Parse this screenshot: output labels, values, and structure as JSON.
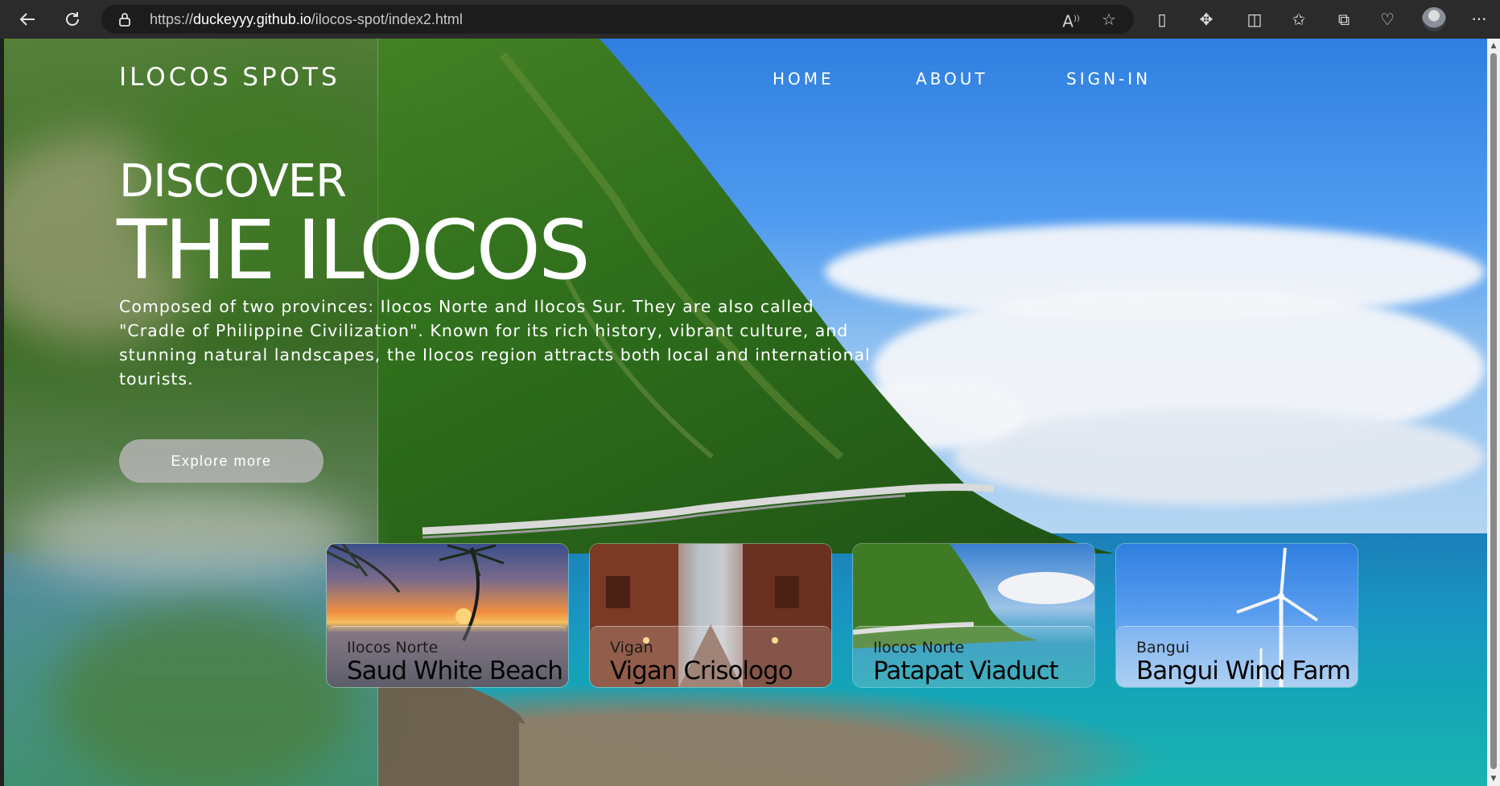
{
  "browser": {
    "url_domain": "duckeyyy.github.io",
    "url_path": "/ilocos-spot/index2.html",
    "url_scheme": "https://",
    "icons": [
      "back-icon",
      "refresh-icon",
      "lock-icon",
      "read-aloud-icon",
      "favorite-star-icon",
      "phone-icon",
      "extensions-icon",
      "split-screen-icon",
      "favorites-icon",
      "collections-icon",
      "health-icon",
      "profile-avatar",
      "more-icon"
    ]
  },
  "site": {
    "logo": "ILOCOS SPOTS",
    "nav": [
      "HOME",
      "ABOUT",
      "SIGN-IN"
    ]
  },
  "hero": {
    "title_small": "DISCOVER",
    "title_big": "THE ILOCOS",
    "description": "Composed of two provinces: Ilocos Norte and Ilocos Sur. They are also called \"Cradle of Philippine Civilization\". Known for its rich history, vibrant culture, and stunning natural landscapes, the Ilocos region attracts both local and international tourists.",
    "button": "Explore more"
  },
  "cards": [
    {
      "location": "Ilocos Norte",
      "name": "Saud White Beach"
    },
    {
      "location": "Vigan",
      "name": "Vigan Crisologo"
    },
    {
      "location": "Ilocos Norte",
      "name": "Patapat Viaduct"
    },
    {
      "location": "Bangui",
      "name": "Bangui Wind Farm"
    }
  ],
  "colors": {
    "chrome_bg": "#2b2b2b",
    "address_bg": "#1c1c1c",
    "button_bg": "#b4b4b4",
    "text": "#ffffff"
  }
}
